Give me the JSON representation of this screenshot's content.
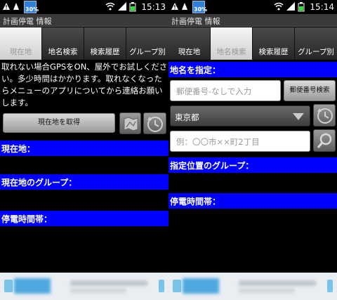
{
  "status_bar": {
    "battery_label": "30%",
    "time_left": "15:13",
    "time_right": "15:14",
    "icons": [
      "warning-icon",
      "wifi-icon",
      "signal-icon",
      "battery-icon"
    ]
  },
  "app": {
    "title": "計画停電 情報"
  },
  "tabs": [
    {
      "label": "現在地"
    },
    {
      "label": "地名検索"
    },
    {
      "label": "検索履歴"
    },
    {
      "label": "グループ別"
    }
  ],
  "left_screen": {
    "message": "取れない場合GPSをON、屋外でお試しください。多少時間はかかります。取れなくなったらメニューのアプリについてから連絡お願いします。",
    "get_location_button": "現在地を取得",
    "sections": [
      {
        "label": "現在地："
      },
      {
        "label": "現在地のグループ："
      },
      {
        "label": "停電時間帯："
      }
    ]
  },
  "right_screen": {
    "place_header": "地名を指定：",
    "postal_placeholder": "郵便番号-なしで入力",
    "postal_search_button": "郵便番号検索",
    "prefecture_selected": "東京都",
    "address_placeholder": "例：〇〇市××町2丁目",
    "sections": [
      {
        "label": "指定位置のグループ："
      },
      {
        "label": "停電時間帯："
      }
    ]
  },
  "colors": {
    "section_blue": "#0000ff",
    "tab_active_bg": "#e8e8e8",
    "tab_inactive_bg": "#3a3a3a"
  }
}
